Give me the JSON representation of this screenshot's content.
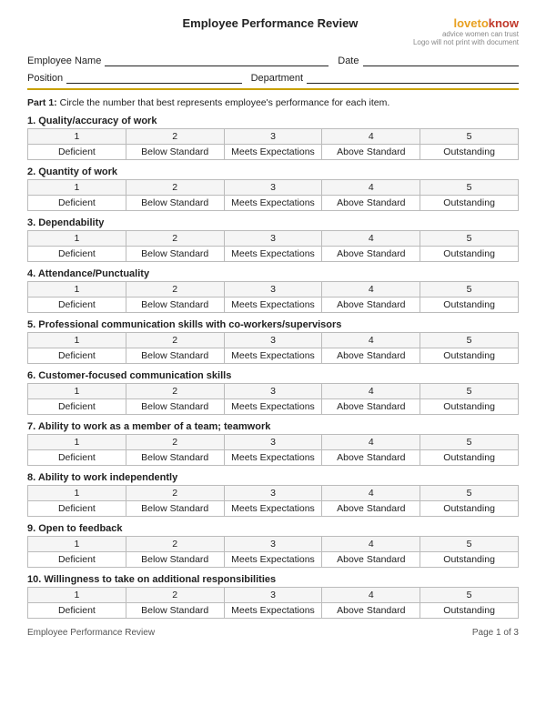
{
  "header": {
    "title": "Employee Performance Review",
    "logo_brand": "lovetoknow",
    "logo_tagline": "advice women can trust",
    "logo_note": "Logo will not print with document"
  },
  "form_fields": {
    "employee_name_label": "Employee Name",
    "date_label": "Date",
    "position_label": "Position",
    "department_label": "Department"
  },
  "part1": {
    "instruction": "Part 1: Circle the number that best represents employee's performance for each item."
  },
  "rating_headers": [
    "1",
    "2",
    "3",
    "4",
    "5"
  ],
  "rating_labels": [
    "Deficient",
    "Below Standard",
    "Meets Expectations",
    "Above Standard",
    "Outstanding"
  ],
  "sections": [
    {
      "number": "1.",
      "title": "Quality/accuracy of work"
    },
    {
      "number": "2.",
      "title": "Quantity of work"
    },
    {
      "number": "3.",
      "title": "Dependability"
    },
    {
      "number": "4.",
      "title": "Attendance/Punctuality"
    },
    {
      "number": "5.",
      "title": "Professional communication skills with co-workers/supervisors"
    },
    {
      "number": "6.",
      "title": "Customer-focused communication skills"
    },
    {
      "number": "7.",
      "title": "Ability to work as a member of a team; teamwork"
    },
    {
      "number": "8.",
      "title": "Ability to work independently"
    },
    {
      "number": "9.",
      "title": "Open to feedback"
    },
    {
      "number": "10.",
      "title": "Willingness to take on additional responsibilities"
    }
  ],
  "footer": {
    "left": "Employee Performance Review",
    "right": "Page 1 of 3"
  }
}
